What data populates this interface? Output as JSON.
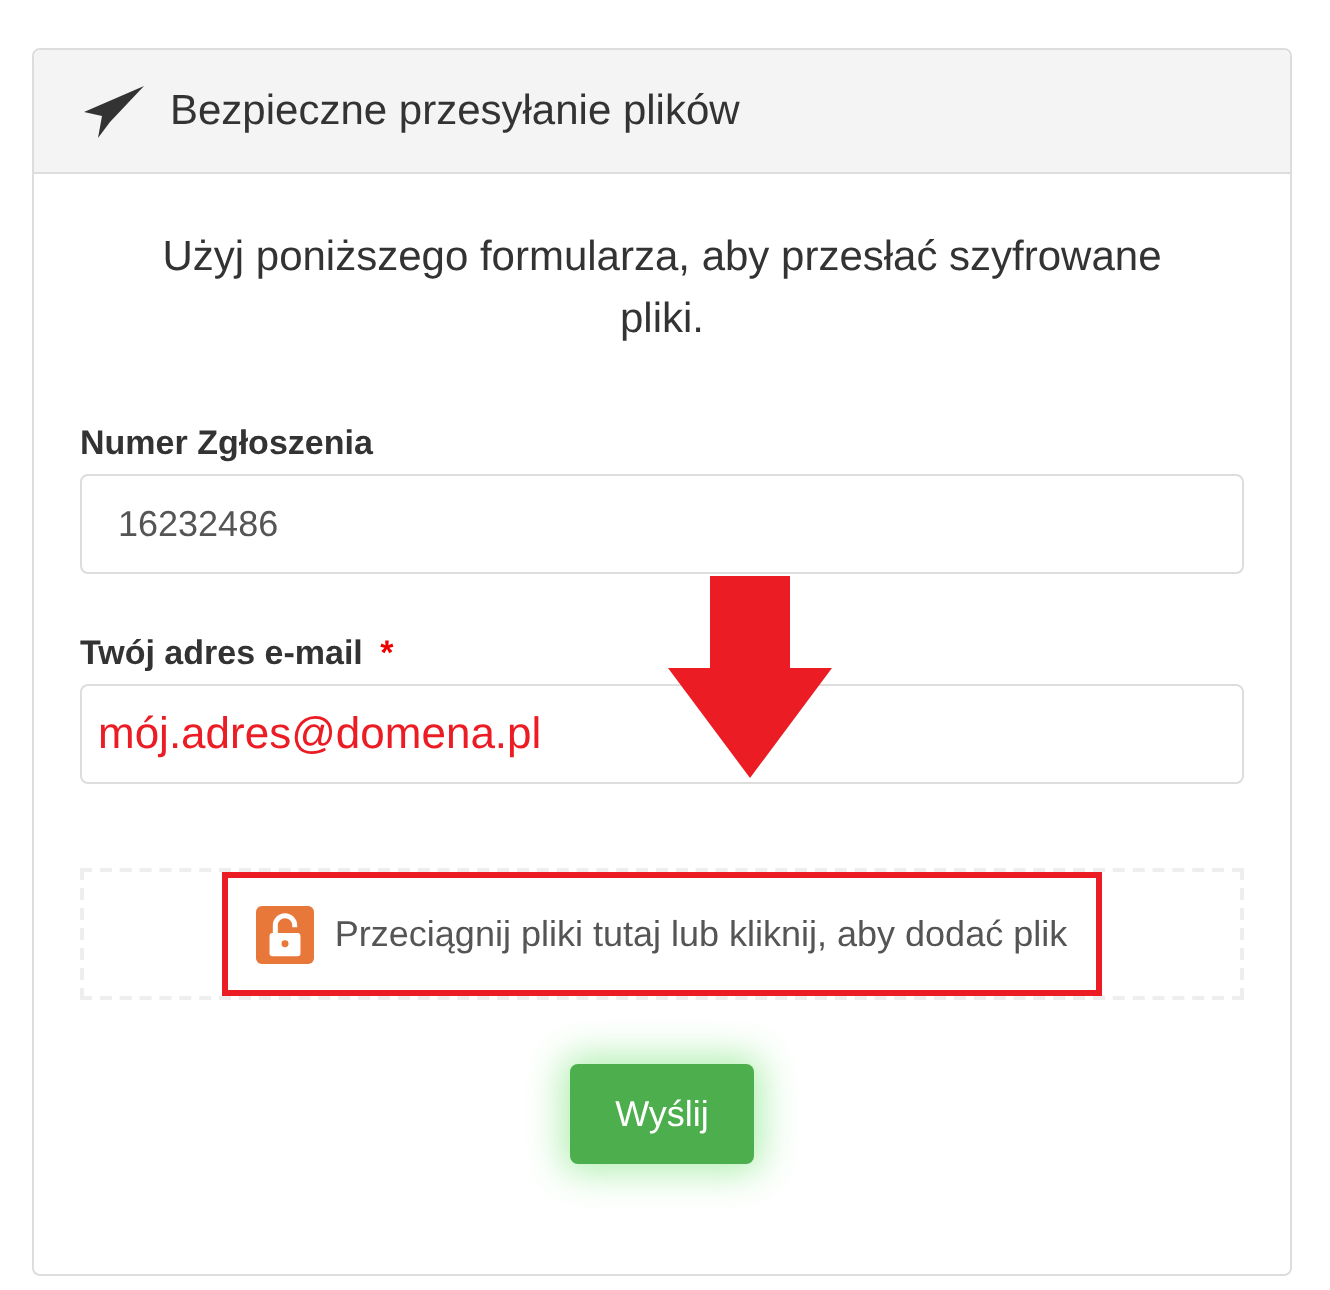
{
  "panel": {
    "title": "Bezpieczne przesyłanie plików"
  },
  "intro": "Użyj poniższego formularza, aby przesłać szyfrowane pliki.",
  "fields": [
    {
      "label": "Numer Zgłoszenia",
      "value": "16232486"
    },
    {
      "label": "Twój adres e-mail",
      "required_mark": "*",
      "value": "mój.adres@domena.pl"
    }
  ],
  "dropzone": {
    "text": "Przeciągnij pliki tutaj lub kliknij, aby dodać plik",
    "highlighted": true
  },
  "submit": {
    "label": "Wyślij"
  },
  "annotation": {
    "arrow": true
  }
}
